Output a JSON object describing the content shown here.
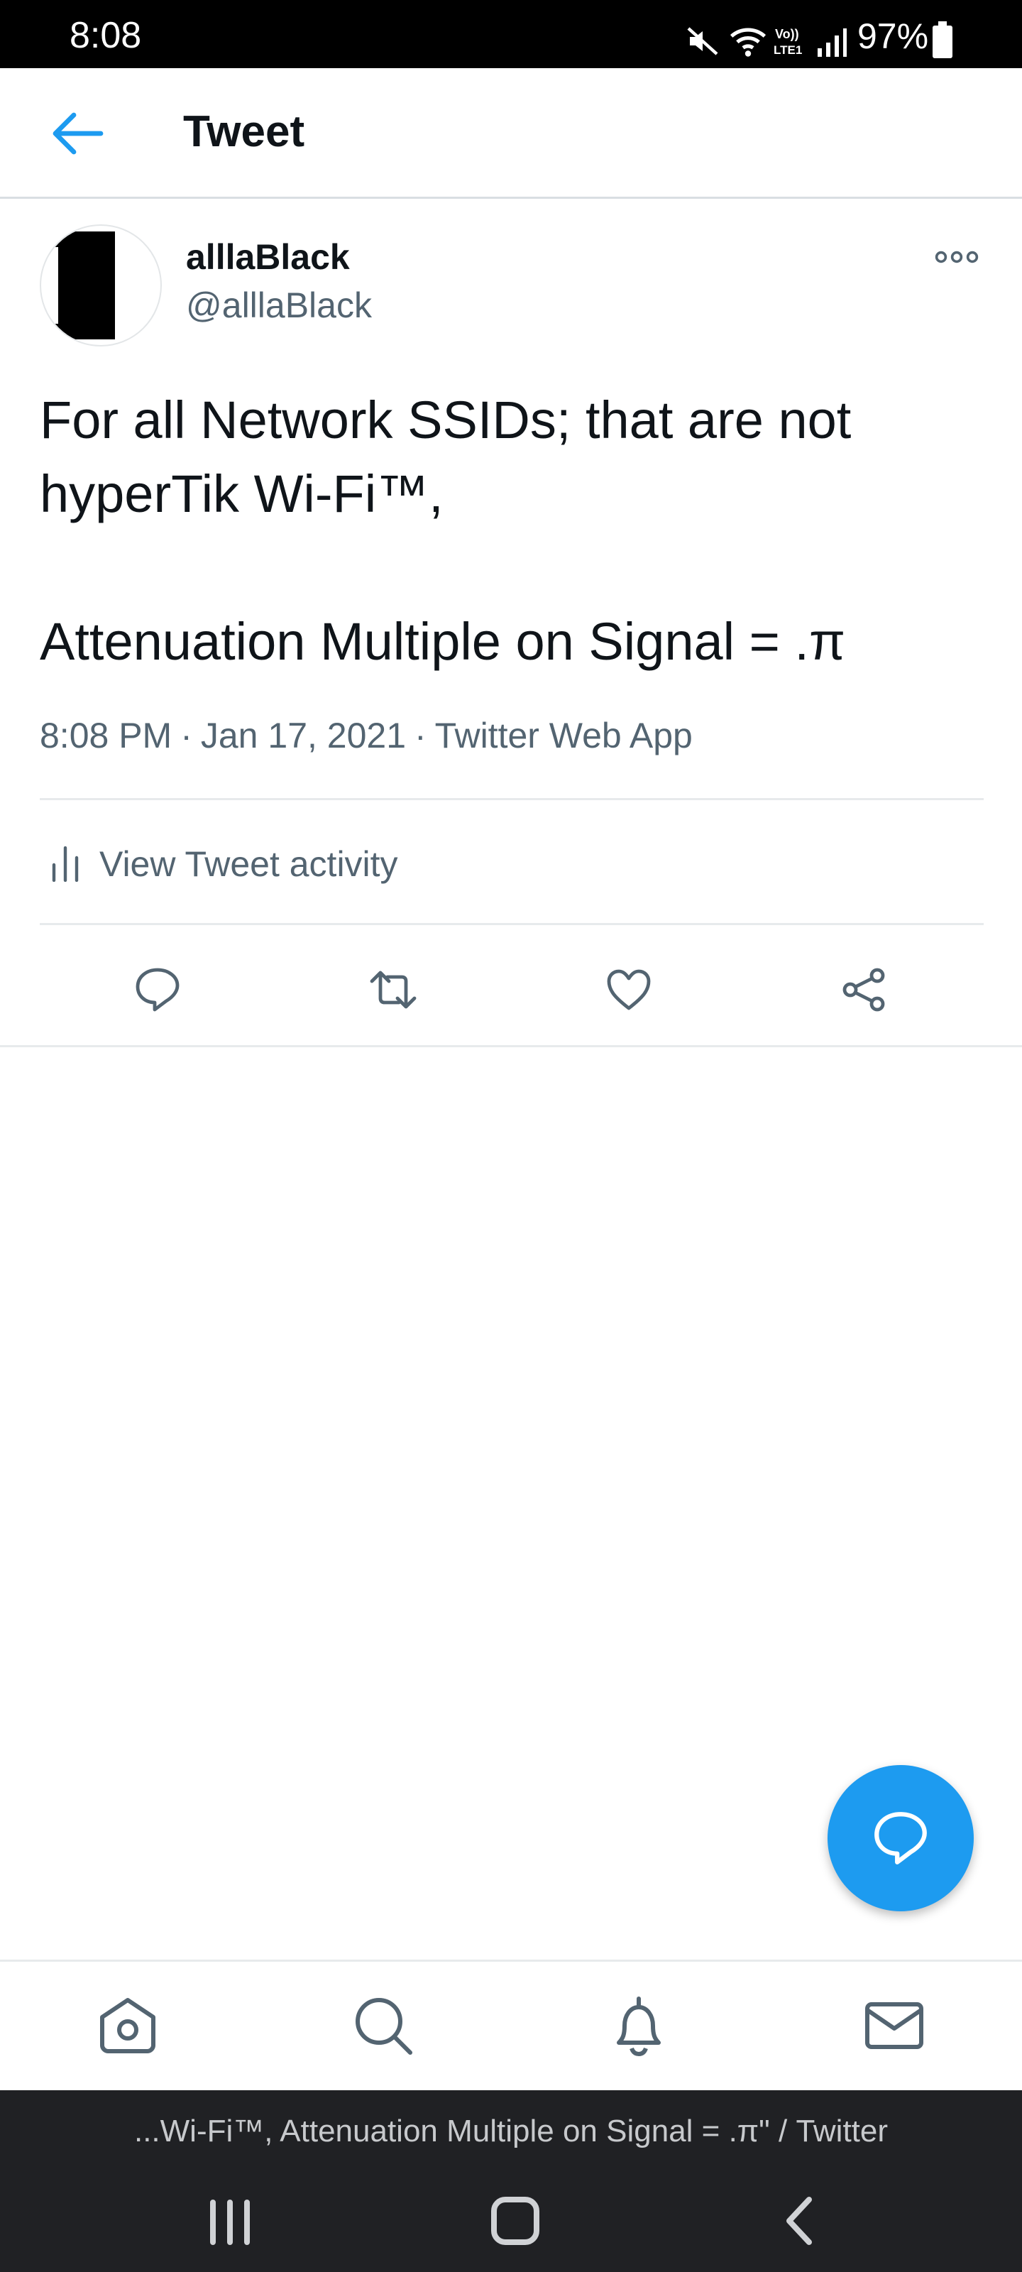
{
  "status_bar": {
    "time": "8:08",
    "battery": "97%",
    "icons": [
      "mute-icon",
      "wifi-icon",
      "volte-lte1-icon",
      "signal-icon",
      "battery-icon"
    ]
  },
  "header": {
    "title": "Tweet",
    "back_icon": "arrow-left-icon"
  },
  "tweet": {
    "display_name": "alllaBlack",
    "handle": "@alllaBlack",
    "text": "For all Network SSIDs; that are not hyperTik Wi-Fi™,\n\nAttenuation Multiple on Signal = .π",
    "time": "8:08 PM",
    "date": "Jan 17, 2021",
    "source": "Twitter Web App",
    "separator": "·",
    "more_icon": "more-icon"
  },
  "activity": {
    "label": "View Tweet activity",
    "icon": "bar-chart-icon"
  },
  "actions": [
    {
      "name": "reply",
      "icon": "reply-icon"
    },
    {
      "name": "retweet",
      "icon": "retweet-icon"
    },
    {
      "name": "like",
      "icon": "heart-icon"
    },
    {
      "name": "share",
      "icon": "share-icon"
    }
  ],
  "fab": {
    "icon": "compose-reply-icon"
  },
  "bottom_nav": [
    {
      "name": "home",
      "icon": "home-icon"
    },
    {
      "name": "search",
      "icon": "search-icon"
    },
    {
      "name": "notifications",
      "icon": "bell-icon"
    },
    {
      "name": "messages",
      "icon": "mail-icon"
    }
  ],
  "system_bar": {
    "caption": "...Wi-Fi™, Attenuation Multiple on Signal = .π\" / Twitter",
    "buttons": [
      "recent-apps-icon",
      "home-button-icon",
      "back-button-icon"
    ]
  },
  "colors": {
    "accent": "#1d9bf0",
    "secondary_text": "#536471",
    "icon_gray": "#536471",
    "status_bar_bg": "#000000",
    "system_bar_bg": "#202124"
  }
}
